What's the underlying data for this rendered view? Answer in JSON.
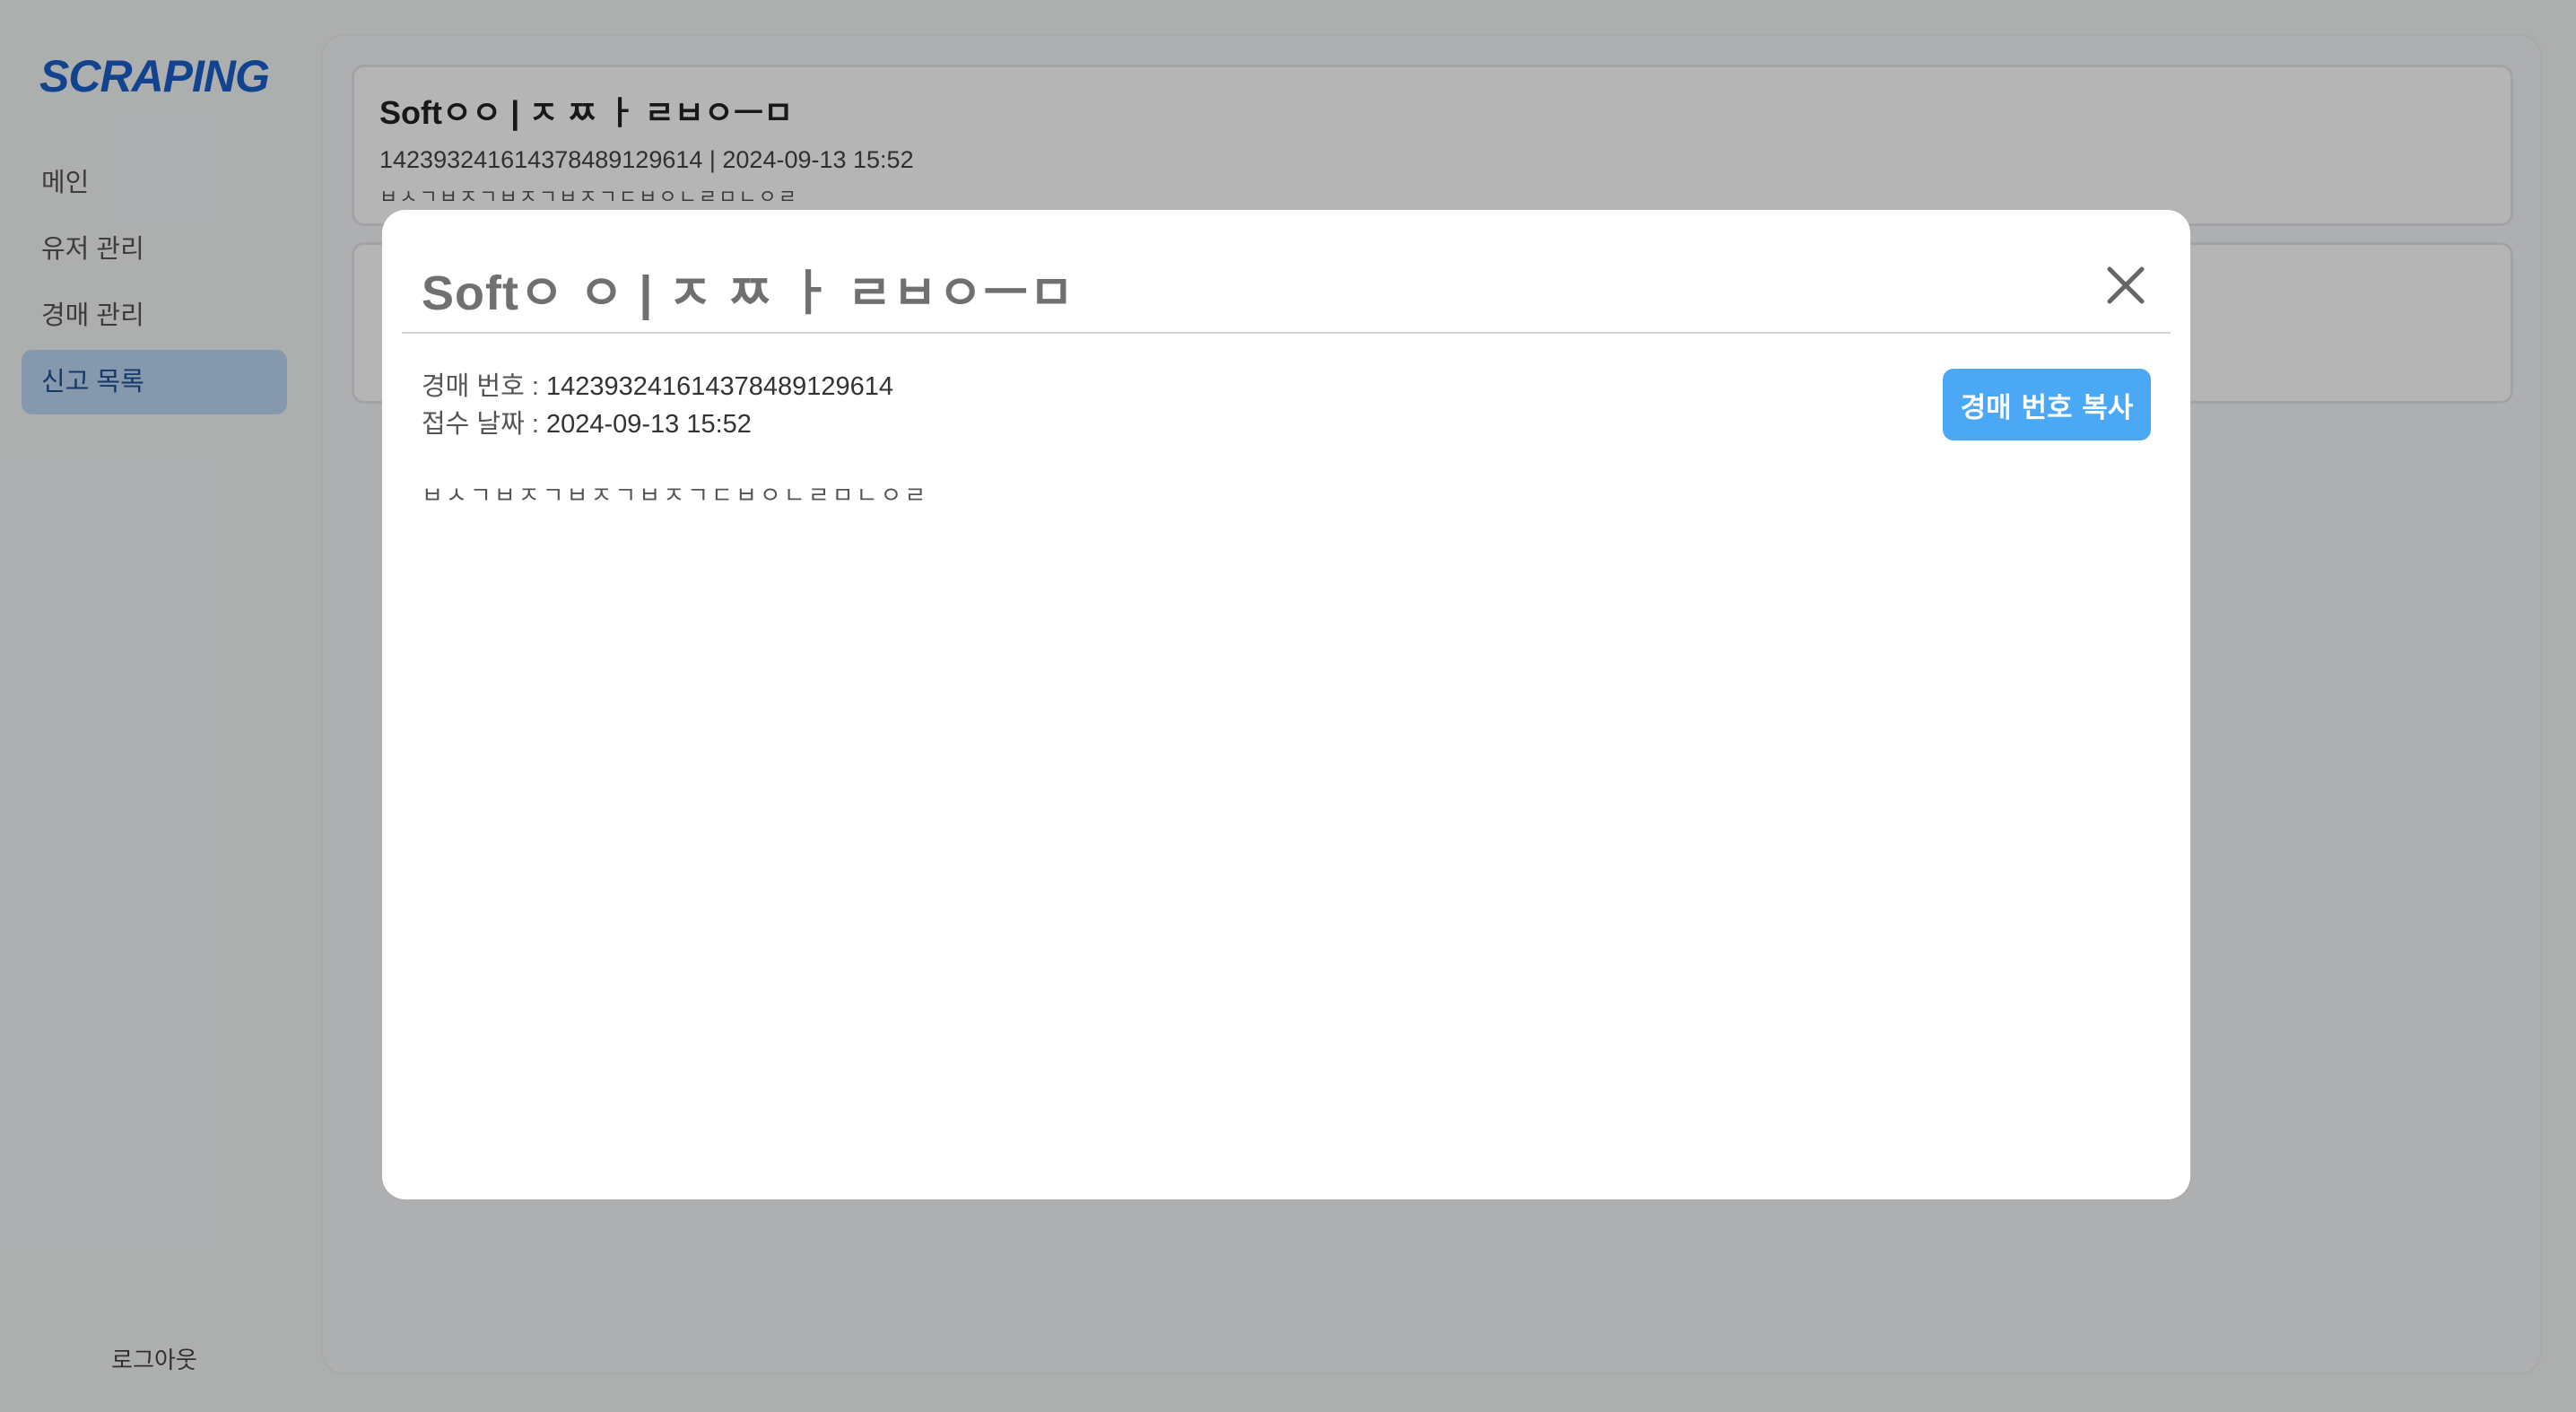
{
  "sidebar": {
    "logo": "SCRAPING",
    "items": [
      {
        "label": "메인"
      },
      {
        "label": "유저 관리"
      },
      {
        "label": "경매 관리"
      },
      {
        "label": "신고 목록"
      }
    ],
    "logout": "로그아웃"
  },
  "cards": [
    {
      "title": "Softㅇㅇ | ㅈ ㅉ ㅏ ㄹㅂㅇㅡㅁ",
      "meta": "14239324161437848912961​4 | 2024-09-13 15:52",
      "body": "ㅂㅅㄱㅂㅈㄱㅂㅈㄱㅂㅈㄱㄷㅂㅇㄴㄹㅁㄴㅇㄹ"
    },
    {
      "title": "",
      "meta": "",
      "body": ""
    }
  ],
  "modal": {
    "title": "Softㅇ ㅇ | ㅈ ㅉ ㅏ ㄹㅂㅇㅡㅁ",
    "auction_label": "경매 번호 : ",
    "auction_value": "14239324161437848912961​4",
    "date_label": "접수 날짜 : ",
    "date_value": "2024-09-13 15:52",
    "copy_button": "경매 번호 복사",
    "body": "ㅂㅅㄱㅂㅈㄱㅂㅈㄱㅂㅈㄱㄷㅂㅇㄴㄹㅁㄴㅇㄹ"
  },
  "colors": {
    "brand": "#1a5fc8",
    "active_nav_bg": "#bcd6f6",
    "copy_button": "#4aa8f5"
  },
  "icons": {
    "close": "close-icon"
  }
}
